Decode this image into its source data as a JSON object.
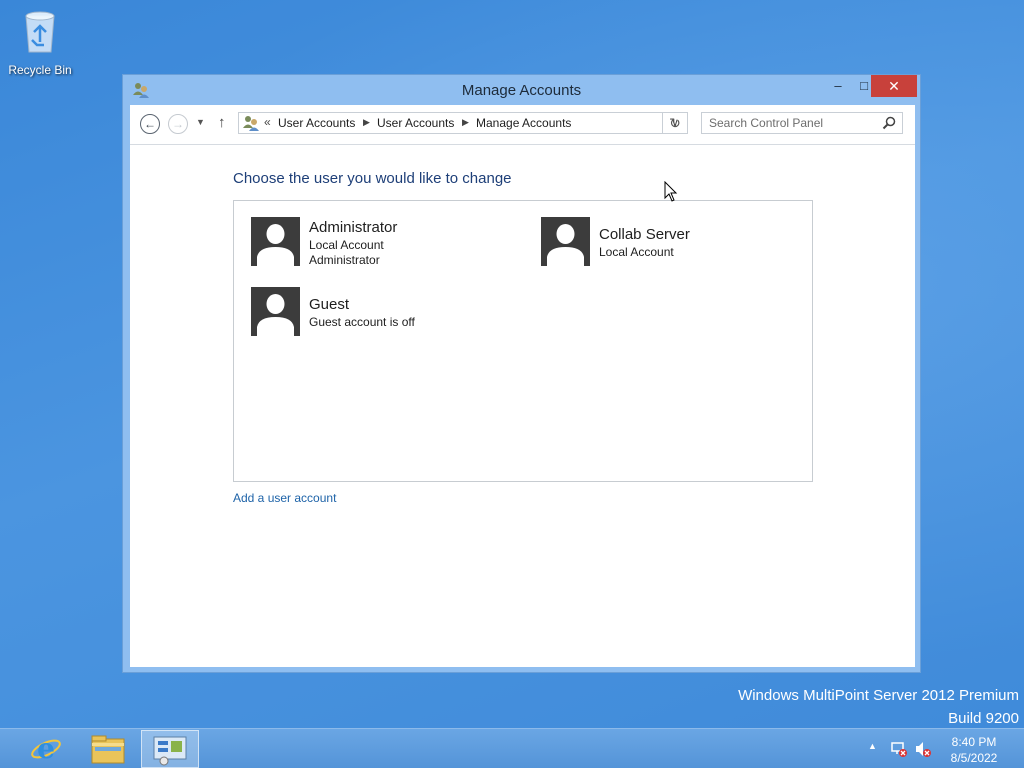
{
  "desktop": {
    "recycle_bin_label": "Recycle Bin",
    "watermark_line1": "Windows MultiPoint Server 2012 Premium",
    "watermark_line2": "Build 9200"
  },
  "window": {
    "title": "Manage Accounts",
    "controls": {
      "minimize": "–",
      "maximize": "□",
      "close": "✕"
    }
  },
  "navbar": {
    "back_glyph": "←",
    "forward_glyph": "→",
    "dropdown_glyph": "▼",
    "up_glyph": "↑",
    "overflow_glyph": "«",
    "breadcrumbs": [
      "User Accounts",
      "User Accounts",
      "Manage Accounts"
    ],
    "crumb_separator": "▶",
    "address_dropdown_glyph": "∨",
    "refresh_glyph": "↻",
    "search_placeholder": "Search Control Panel"
  },
  "main": {
    "heading": "Choose the user you would like to change",
    "accounts": [
      {
        "name": "Administrator",
        "lines": [
          "Local Account",
          "Administrator"
        ]
      },
      {
        "name": "Collab Server",
        "lines": [
          "Local Account"
        ]
      },
      {
        "name": "Guest",
        "lines": [
          "Guest account is off"
        ]
      }
    ],
    "add_account_link": "Add a user account"
  },
  "taskbar": {
    "items": [
      "internet-explorer-icon",
      "file-explorer-icon",
      "control-panel-icon"
    ],
    "tray_arrow": "▲",
    "time": "8:40 PM",
    "date": "8/5/2022"
  },
  "colors": {
    "desktop": "#3f8ad9",
    "window_frame": "#8fbef0",
    "close_button": "#c8413b",
    "heading": "#1e3f78",
    "link": "#1e63a8",
    "avatar": "#3c3c3c"
  }
}
